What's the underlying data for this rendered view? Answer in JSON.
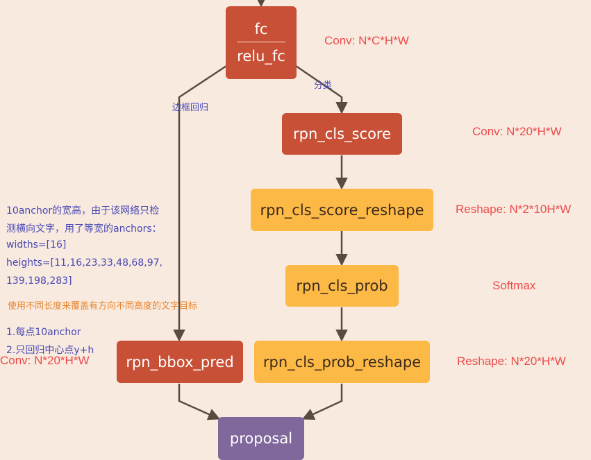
{
  "nodes": {
    "fc": "fc",
    "relu_fc": "relu_fc",
    "rpn_cls_score": "rpn_cls_score",
    "rpn_cls_score_reshape": "rpn_cls_score_reshape",
    "rpn_cls_prob": "rpn_cls_prob",
    "rpn_cls_prob_reshape": "rpn_cls_prob_reshape",
    "rpn_bbox_pred": "rpn_bbox_pred",
    "proposal": "proposal"
  },
  "dims": {
    "fc": "Conv: N*C*H*W",
    "rpn_cls_score": "Conv: N*20*H*W",
    "rpn_cls_score_reshape": "Reshape: N*2*10H*W",
    "rpn_cls_prob": "Softmax",
    "rpn_cls_prob_reshape": "Reshape: N*20*H*W",
    "rpn_bbox_pred": "Conv: N*20*H*W"
  },
  "edge_labels": {
    "bbox_branch": "边框回归",
    "cls_branch": "分类"
  },
  "notes": [
    "10anchor的宽高，由于该网络只检",
    "测横向文字，用了等宽的anchors：",
    "widths=[16]",
    "heights=[11,16,23,33,48,68,97,",
    "139,198,283]",
    "使用不同长度来覆盖有方向不同高度的文字目标",
    "1.每点10anchor",
    "2.只回归中心点y+h"
  ],
  "colors": {
    "conv_node": "#c85036",
    "reshape_node": "#fdb945",
    "proposal_node": "#80689c",
    "dim_text": "#ec4b4b",
    "note_text": "#4848b4",
    "note_highlight": "#e8832a",
    "edge": "#5a4a40"
  }
}
